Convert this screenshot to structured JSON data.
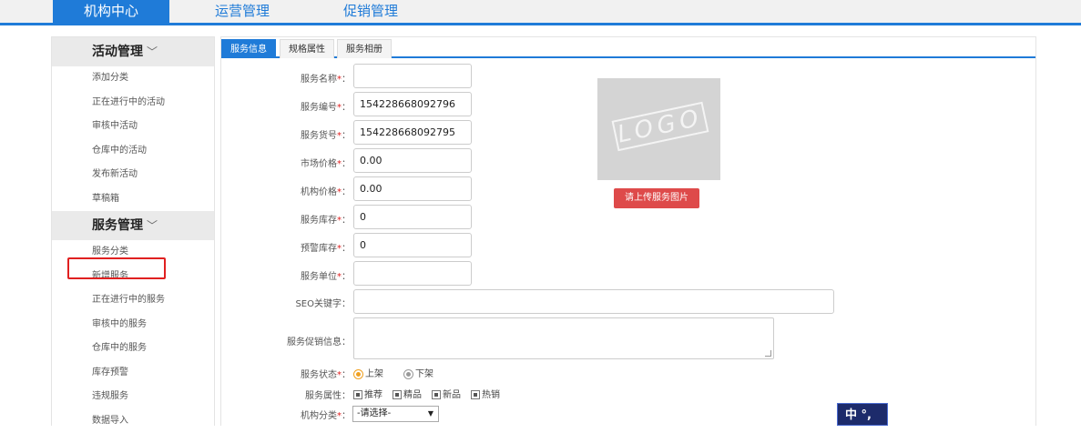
{
  "top_nav": {
    "tabs": [
      {
        "label": "机构中心",
        "active": true
      },
      {
        "label": "运营管理",
        "active": false
      },
      {
        "label": "促销管理",
        "active": false
      }
    ]
  },
  "sidebar": {
    "sections": [
      {
        "title": "活动管理",
        "items": [
          "添加分类",
          "正在进行中的活动",
          "审核中活动",
          "仓库中的活动",
          "发布新活动",
          "草稿箱"
        ]
      },
      {
        "title": "服务管理",
        "items": [
          "服务分类",
          "新增服务",
          "正在进行中的服务",
          "审核中的服务",
          "仓库中的服务",
          "库存预警",
          "违规服务",
          "数据导入"
        ]
      }
    ],
    "chevron": "﹀"
  },
  "sub_tabs": [
    "服务信息",
    "规格属性",
    "服务相册"
  ],
  "form": {
    "required_mark": "*",
    "colon": "：",
    "fields": {
      "name": {
        "label": "服务名称",
        "value": ""
      },
      "code": {
        "label": "服务编号",
        "value": "154228668092796"
      },
      "sku": {
        "label": "服务货号",
        "value": "154228668092795"
      },
      "market_price": {
        "label": "市场价格",
        "value": "0.00"
      },
      "org_price": {
        "label": "机构价格",
        "value": "0.00"
      },
      "stock": {
        "label": "服务库存",
        "value": "0"
      },
      "alert_stock": {
        "label": "预警库存",
        "value": "0"
      },
      "unit": {
        "label": "服务单位",
        "value": ""
      },
      "seo": {
        "label": "SEO关键字",
        "value": ""
      },
      "promo": {
        "label": "服务促销信息",
        "value": ""
      }
    },
    "status": {
      "label": "服务状态",
      "options": [
        "上架",
        "下架"
      ],
      "selected": "上架"
    },
    "attributes": {
      "label": "服务属性",
      "options": [
        "推荐",
        "精品",
        "新品",
        "热销"
      ]
    },
    "category": {
      "label": "机构分类",
      "selected": "-请选择-"
    }
  },
  "image": {
    "placeholder_text": "LOGO",
    "upload_label": "请上传服务图片"
  },
  "ime": {
    "label": "中 °,"
  },
  "colors": {
    "accent": "#1f7bd8",
    "danger": "#de4a4a",
    "highlight": "#e02020"
  }
}
